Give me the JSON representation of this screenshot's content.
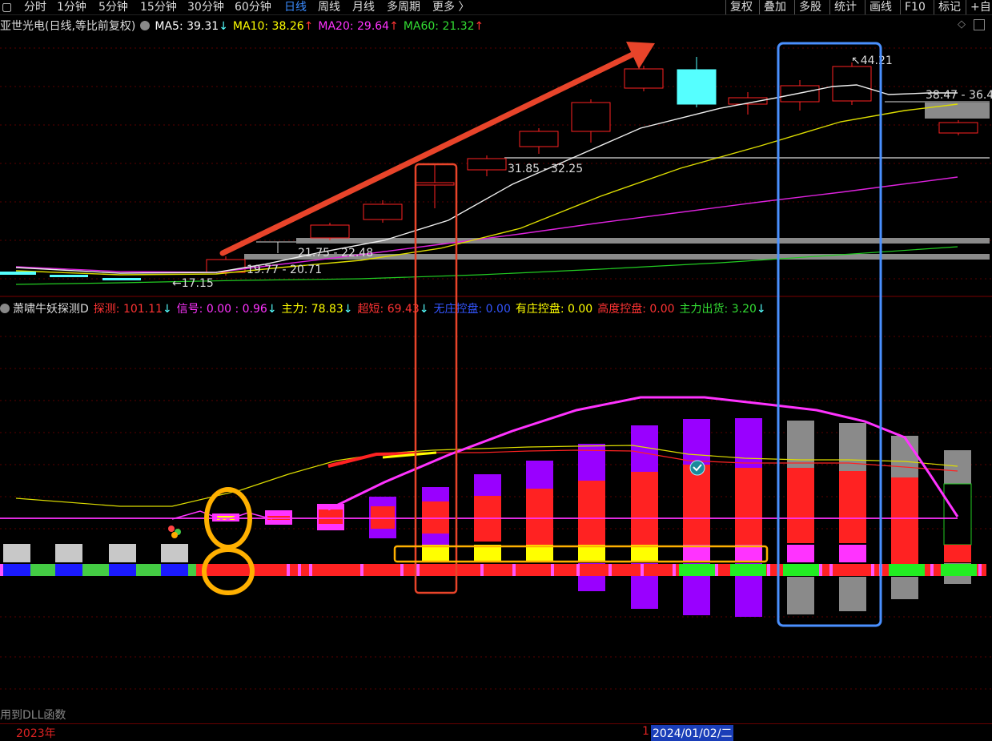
{
  "toolbar": {
    "left_items": [
      "分时",
      "1分钟",
      "5分钟",
      "15分钟",
      "30分钟",
      "60分钟",
      "日线",
      "周线",
      "月线",
      "多周期",
      "更多 〉"
    ],
    "active": "日线",
    "right_items": [
      "复权",
      "叠加",
      "多股",
      "统计",
      "画线",
      "F10",
      "标记",
      "+自"
    ]
  },
  "main_chart": {
    "title": "亚世光电(日线,等比前复权)",
    "ma": [
      {
        "label": "MA5: 39.31",
        "arrow": "↓",
        "color": "#ffffff"
      },
      {
        "label": "MA10: 38.26",
        "arrow": "↑",
        "color": "#ffff00"
      },
      {
        "label": "MA20: 29.64",
        "arrow": "↑",
        "color": "#ff33ff"
      },
      {
        "label": "MA60: 21.32",
        "arrow": "↑",
        "color": "#33dd33"
      }
    ],
    "price_labels": {
      "low": "17.15",
      "zone1": "19.77 - 20.71",
      "zone2": "21.75 - 22.48",
      "zone3": "31.85 - 32.25",
      "zone4": "38.47 - 36.4",
      "high": "44.21"
    }
  },
  "indicator": {
    "title": "萧啸牛妖探测D",
    "items": [
      {
        "label": "探测: 101.11",
        "arrow": "↓",
        "color": "#ff3333"
      },
      {
        "label": "信号: 0.00 : 0.96",
        "arrow": "↓",
        "color": "#ff33ff"
      },
      {
        "label": "主力: 78.83",
        "arrow": "↓",
        "color": "#ffff00"
      },
      {
        "label": "超短: 69.43",
        "arrow": "↓",
        "color": "#ff3333"
      },
      {
        "label": "无庄控盘: 0.00",
        "arrow": "",
        "color": "#3355ff"
      },
      {
        "label": "有庄控盘: 0.00",
        "arrow": "",
        "color": "#ffff00"
      },
      {
        "label": "高度控盘: 0.00",
        "arrow": "",
        "color": "#ff3333"
      },
      {
        "label": "主力出货: 3.20",
        "arrow": "↓",
        "color": "#33dd33"
      }
    ]
  },
  "footer_note": "用到DLL函数",
  "timeline": {
    "year": "2023年",
    "cursor_mark": "1",
    "cursor_date": "2024/01/02/二"
  },
  "colors": {
    "up": "#ff2222",
    "down": "#55ffff",
    "annotation_arrow": "#e8442a",
    "annotation_box_blue": "#4a90ff",
    "annotation_box_orange": "#ffb000"
  }
}
